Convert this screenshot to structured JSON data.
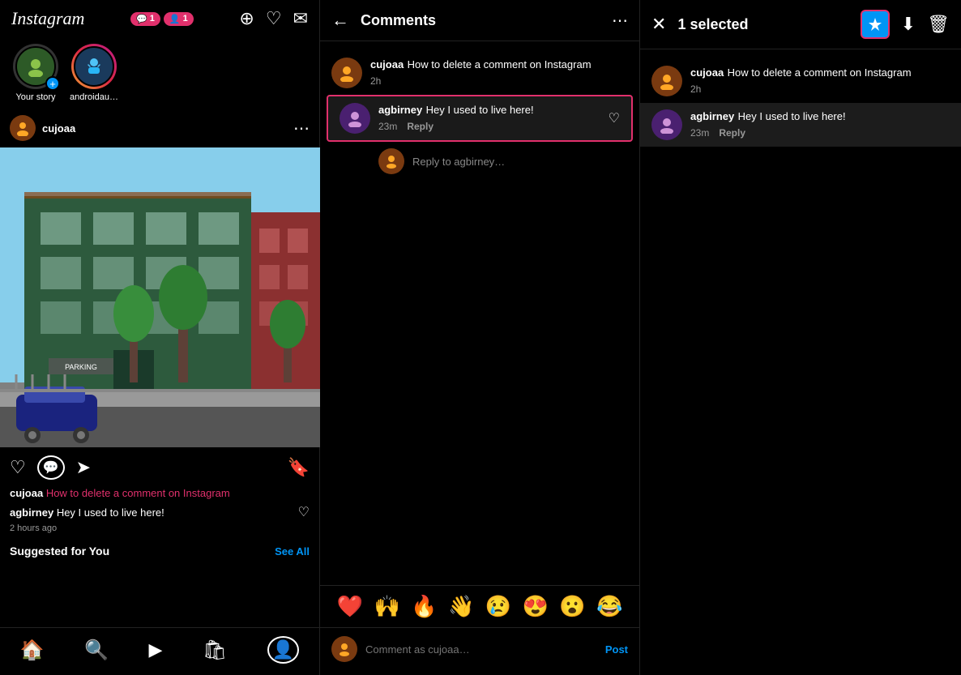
{
  "feed": {
    "logo": "Instagram",
    "header_icons": {
      "add": "+",
      "heart": "♡",
      "messenger": "✉"
    },
    "notifications": {
      "comments_count": "1",
      "follow_count": "1"
    },
    "stories": [
      {
        "label": "Your story",
        "has_ring": false,
        "emoji": "📷",
        "is_yours": true
      },
      {
        "label": "androidauth...",
        "has_ring": true,
        "emoji": "🤖"
      }
    ],
    "post": {
      "username": "cujoaa",
      "caption_username": "cujoaa",
      "caption_link": "How to delete a comment on Instagram",
      "comment_username": "agbirney",
      "comment_text": "Hey I used to live here!",
      "time_ago": "2 hours ago"
    },
    "suggested": {
      "title": "Suggested for You",
      "see_all": "See All"
    },
    "nav": {
      "home": "🏠",
      "search": "🔍",
      "reels": "▶",
      "shop": "🛍",
      "profile": "👤"
    }
  },
  "comments": {
    "title": "Comments",
    "items": [
      {
        "username": "cujoaa",
        "text": "How to delete a comment on Instagram",
        "time": "2h",
        "is_selected": false
      },
      {
        "username": "agbirney",
        "text": "Hey I used to live here!",
        "time": "23m",
        "reply": "Reply",
        "is_selected": true
      }
    ],
    "reply_to": "Reply to agbirney…",
    "emojis": [
      "❤️",
      "🙌",
      "🔥",
      "👋",
      "😢",
      "😍",
      "😮",
      "😂"
    ],
    "input_placeholder": "Comment as cujoaa…",
    "post_btn": "Post"
  },
  "selected_panel": {
    "count": "1 selected",
    "items": [
      {
        "username": "cujoaa",
        "text": "How to delete a comment on Instagram",
        "time": "2h",
        "is_first": true
      },
      {
        "username": "agbirney",
        "text": "Hey I used to live here!",
        "time": "23m",
        "reply": "Reply",
        "is_highlighted": true
      }
    ]
  }
}
